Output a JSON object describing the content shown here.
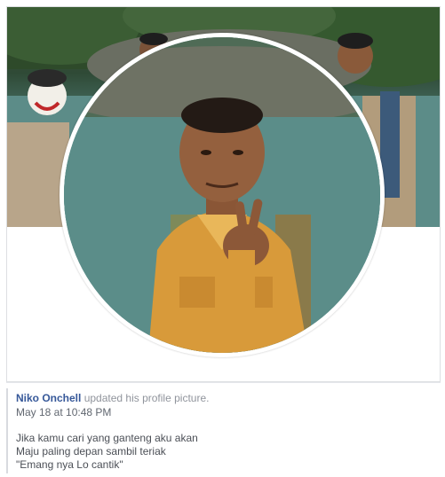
{
  "post": {
    "author": "Niko Onchell",
    "action": "updated his profile picture.",
    "timestamp": "May 18 at 10:48 PM",
    "message_lines": [
      "Jika kamu cari yang ganteng aku akan",
      "Maju paling depan sambil teriak",
      "\"Emang nya Lo cantik\""
    ]
  },
  "colors": {
    "author_link": "#365899",
    "secondary_text": "#90949c",
    "card_border": "#dddfe2",
    "shirt": "#d89a3a"
  }
}
